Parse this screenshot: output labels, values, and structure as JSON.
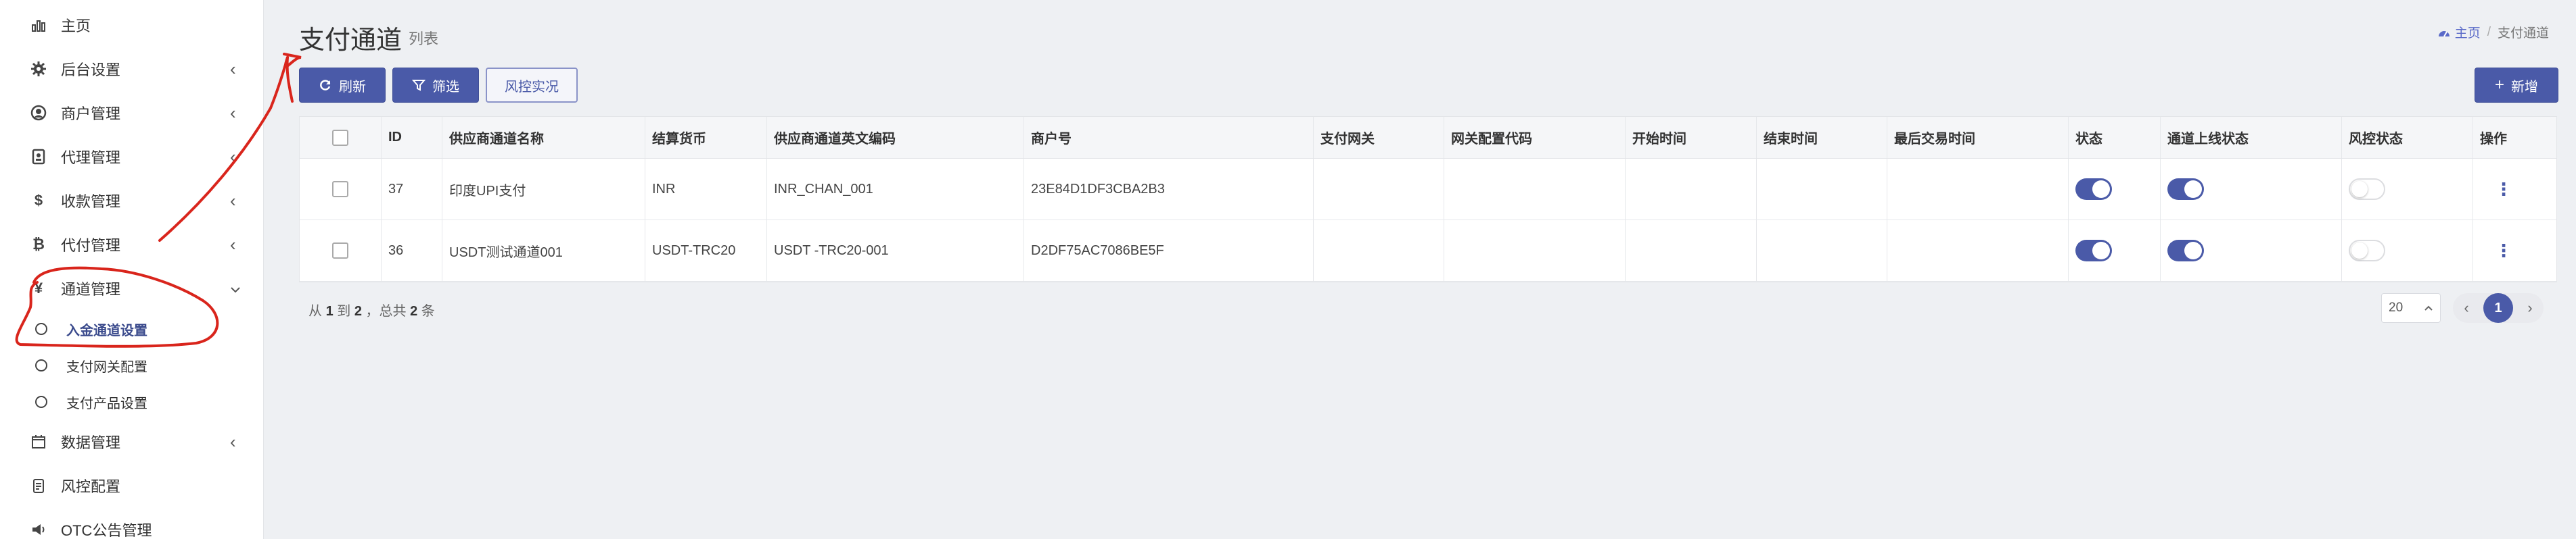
{
  "sidebar": {
    "items": [
      {
        "label": "主页",
        "icon": "bar-chart-icon",
        "glyph": "📊",
        "has_children": false
      },
      {
        "label": "后台设置",
        "icon": "gear-icon",
        "glyph": "⚙",
        "has_children": true
      },
      {
        "label": "商户管理",
        "icon": "user-circle-icon",
        "glyph": "◉",
        "has_children": true
      },
      {
        "label": "代理管理",
        "icon": "id-card-icon",
        "glyph": "▣",
        "has_children": true
      },
      {
        "label": "收款管理",
        "icon": "dollar-icon",
        "glyph": "$",
        "has_children": true
      },
      {
        "label": "代付管理",
        "icon": "bitcoin-icon",
        "glyph": "₿",
        "has_children": true
      },
      {
        "label": "通道管理",
        "icon": "yen-icon",
        "glyph": "¥",
        "has_children": true,
        "expanded": true
      },
      {
        "label": "数据管理",
        "icon": "calendar-icon",
        "glyph": "▦",
        "has_children": true
      },
      {
        "label": "风控配置",
        "icon": "clipboard-icon",
        "glyph": "▤",
        "has_children": false
      },
      {
        "label": "OTC公告管理",
        "icon": "megaphone-icon",
        "glyph": "◀",
        "has_children": false
      }
    ],
    "sub_items": [
      {
        "label": "入金通道设置",
        "active": true
      },
      {
        "label": "支付网关配置",
        "active": false
      },
      {
        "label": "支付产品设置",
        "active": false
      }
    ],
    "chevron_collapsed": "‹",
    "chevron_expanded": "⌄"
  },
  "header": {
    "title": "支付通道",
    "subtitle": "列表",
    "breadcrumb_home": "主页",
    "breadcrumb_sep": "/",
    "breadcrumb_current": "支付通道"
  },
  "toolbar": {
    "refresh_label": "刷新",
    "filter_label": "筛选",
    "risk_label": "风控实况",
    "add_label": "新增"
  },
  "table": {
    "columns": [
      "",
      "ID",
      "供应商通道名称",
      "结算货币",
      "供应商通道英文编码",
      "商户号",
      "支付网关",
      "网关配置代码",
      "开始时间",
      "结束时间",
      "最后交易时间",
      "状态",
      "通道上线状态",
      "风控状态",
      "操作"
    ],
    "rows": [
      {
        "id": "37",
        "name": "印度UPI支付",
        "currency": "INR",
        "code": "INR_CHAN_001",
        "merchant": "23E84D1DF3CBA2B3",
        "gateway": "",
        "gateway_code": "",
        "start": "",
        "end": "",
        "last_trade": "",
        "status_on": true,
        "online_on": true,
        "risk_on": false
      },
      {
        "id": "36",
        "name": "USDT测试通道001",
        "currency": "USDT-TRC20",
        "code": "USDT -TRC20-001",
        "merchant": "D2DF75AC7086BE5F",
        "gateway": "",
        "gateway_code": "",
        "start": "",
        "end": "",
        "last_trade": "",
        "status_on": true,
        "online_on": true,
        "risk_on": false
      }
    ]
  },
  "pagination": {
    "prefix": "从",
    "from": "1",
    "to_word": "到",
    "to": "2",
    "total_prefix": "，总共",
    "total": "2",
    "suffix": "条",
    "page_size": "20",
    "current_page": "1",
    "prev": "‹",
    "next": "›"
  },
  "colors": {
    "primary": "#4a5aa8",
    "annotation": "#d9251c"
  }
}
